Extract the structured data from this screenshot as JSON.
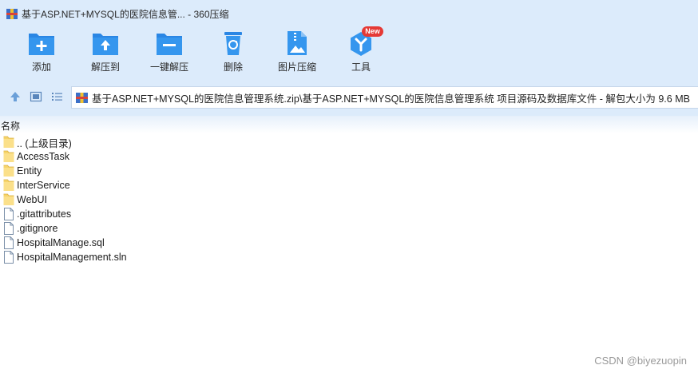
{
  "window": {
    "title": "基于ASP.NET+MYSQL的医院信息管... - 360压缩"
  },
  "toolbar": {
    "items": [
      {
        "label": "添加",
        "icon": "add-icon",
        "color": "#2d8ae6"
      },
      {
        "label": "解压到",
        "icon": "extract-to-icon",
        "color": "#2d8ae6"
      },
      {
        "label": "一键解压",
        "icon": "one-click-extract-icon",
        "color": "#2d8ae6"
      },
      {
        "label": "删除",
        "icon": "delete-icon",
        "color": "#2d8ae6"
      },
      {
        "label": "图片压缩",
        "icon": "image-compress-icon",
        "color": "#2d8ae6"
      },
      {
        "label": "工具",
        "icon": "tools-icon",
        "color": "#2d8ae6",
        "badge": "New"
      }
    ]
  },
  "address": {
    "path": "基于ASP.NET+MYSQL的医院信息管理系统.zip\\基于ASP.NET+MYSQL的医院信息管理系统 项目源码及数据库文件 - 解包大小为 9.6 MB"
  },
  "list": {
    "column_name": "名称",
    "items": [
      {
        "name": ".. (上级目录)",
        "type": "folder"
      },
      {
        "name": "AccessTask",
        "type": "folder"
      },
      {
        "name": "Entity",
        "type": "folder"
      },
      {
        "name": "InterService",
        "type": "folder"
      },
      {
        "name": "WebUI",
        "type": "folder"
      },
      {
        "name": ".gitattributes",
        "type": "file"
      },
      {
        "name": ".gitignore",
        "type": "file"
      },
      {
        "name": "HospitalManage.sql",
        "type": "file"
      },
      {
        "name": "HospitalManagement.sln",
        "type": "file"
      }
    ]
  },
  "watermark": "CSDN @biyezuopin"
}
